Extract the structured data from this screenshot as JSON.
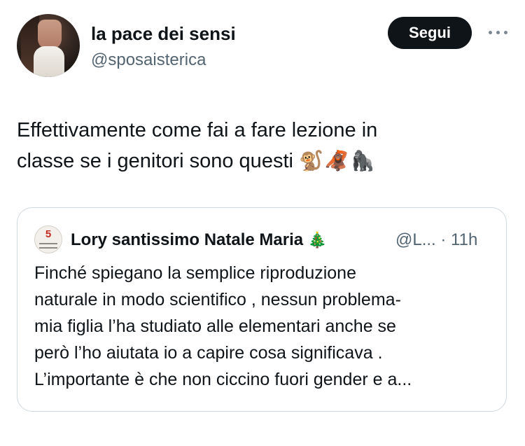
{
  "author": {
    "display_name": "la pace dei sensi",
    "handle": "@sposaisterica",
    "avatar_icon": "profile-photo"
  },
  "actions": {
    "follow_label": "Segui",
    "more_icon": "more-horizontal-icon"
  },
  "tweet": {
    "line1": "Effettivamente come fai a fare lezione in",
    "line2": "classe se i genitori sono questi",
    "emojis": "🐒🦧🦍"
  },
  "quoted_tweet": {
    "display_name": "Lory santissimo Natale Maria",
    "name_emoji": "🎄",
    "handle_time": "@L... · 11h",
    "lines": [
      "Finché spiegano la semplice riproduzione",
      "naturale in modo scientifico , nessun problema-",
      "mia figlia l’ha studiato alle elementari anche se",
      "però l’ho aiutata io a capire cosa significava .",
      "L’importante è che non ciccino fuori gender e a..."
    ]
  }
}
